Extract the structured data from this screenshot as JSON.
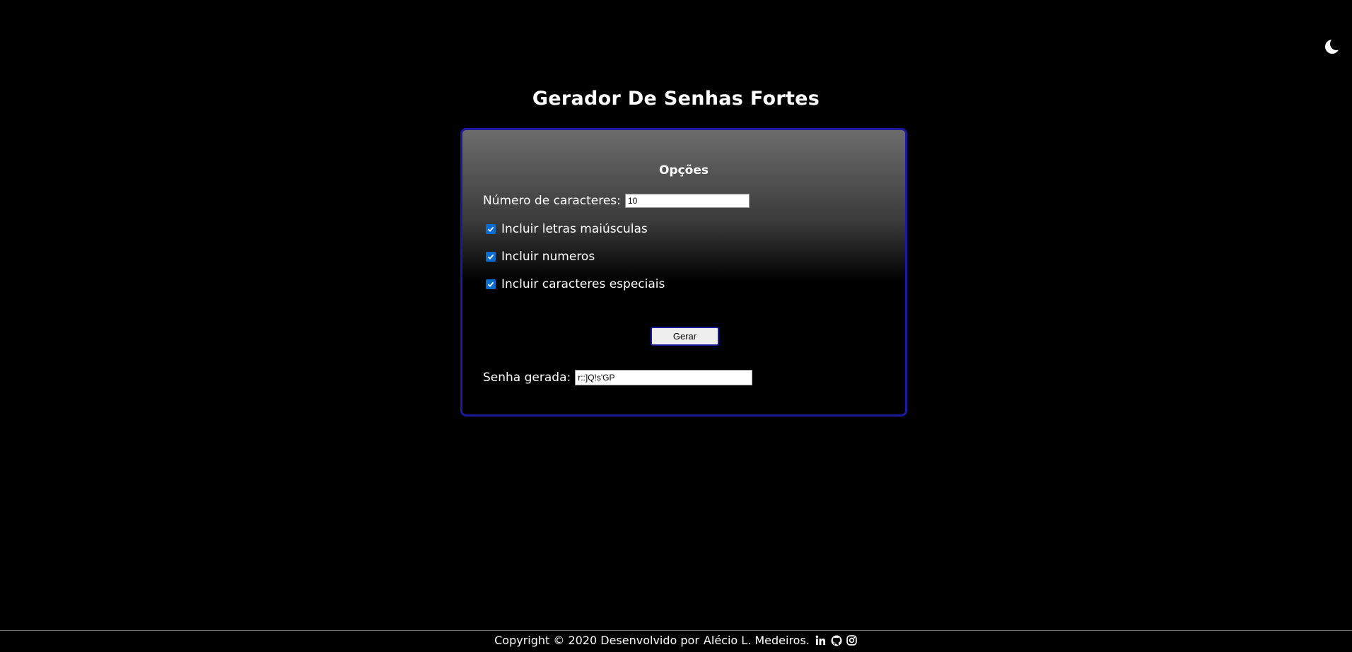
{
  "header": {
    "title": "Gerador De Senhas Fortes",
    "theme_toggle_icon": "moon-icon"
  },
  "options": {
    "heading": "Opções",
    "length_label": "Número de caracteres:",
    "length_value": "10",
    "uppercase_label": "Incluir letras maiúsculas",
    "uppercase_checked": true,
    "numbers_label": "Incluir numeros",
    "numbers_checked": true,
    "special_label": "Incluir caracteres especiais",
    "special_checked": true,
    "generate_button": "Gerar",
    "result_label": "Senha gerada:",
    "result_value": "r::]Q!s'GP"
  },
  "footer": {
    "copyright": "Copyright © 2020 Desenvolvido por",
    "author": "Alécio L. Medeiros.",
    "icons": [
      "linkedin-icon",
      "github-icon",
      "instagram-icon"
    ]
  },
  "colors": {
    "background": "#000000",
    "panel_border": "#1a1a9a",
    "checkbox_accent": "#0a6ccf"
  }
}
